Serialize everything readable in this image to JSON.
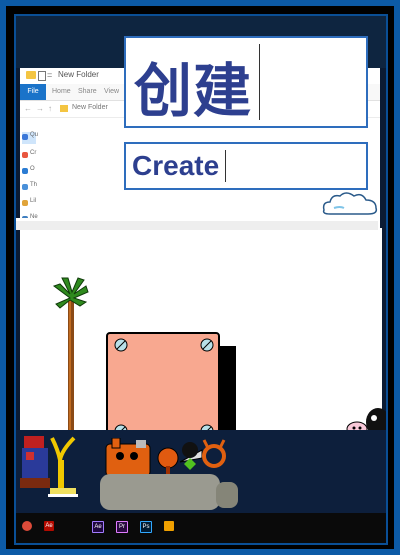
{
  "dialog": {
    "chinese_text": "创建",
    "english_text": "Create"
  },
  "explorer": {
    "title": "New Folder",
    "path": "New Folder",
    "ribbon_file": "File",
    "ribbon_tabs": [
      "Home",
      "Share",
      "View"
    ],
    "sidebar_items": [
      "Qu",
      "Cr",
      "O",
      "Th",
      "Lil",
      "Ne"
    ]
  },
  "taskbar": {
    "icons": [
      {
        "name": "chrome-icon",
        "label": "",
        "color": "#dd4b39"
      },
      {
        "name": "acrobat-icon",
        "label": "Ae",
        "color": "#b30b00"
      },
      {
        "name": "after-effects-icon",
        "label": "Ae",
        "color": "#1f0740"
      },
      {
        "name": "premiere-icon",
        "label": "Pr",
        "color": "#2a0a40"
      },
      {
        "name": "photoshop-icon",
        "label": "Ps",
        "color": "#001b33"
      },
      {
        "name": "game-icon",
        "label": "",
        "color": "#f0a000"
      }
    ]
  },
  "colors": {
    "frame": "#0c5aa6",
    "dialog_text": "#2d3f8f",
    "dialog_border": "#2e6dbd"
  }
}
